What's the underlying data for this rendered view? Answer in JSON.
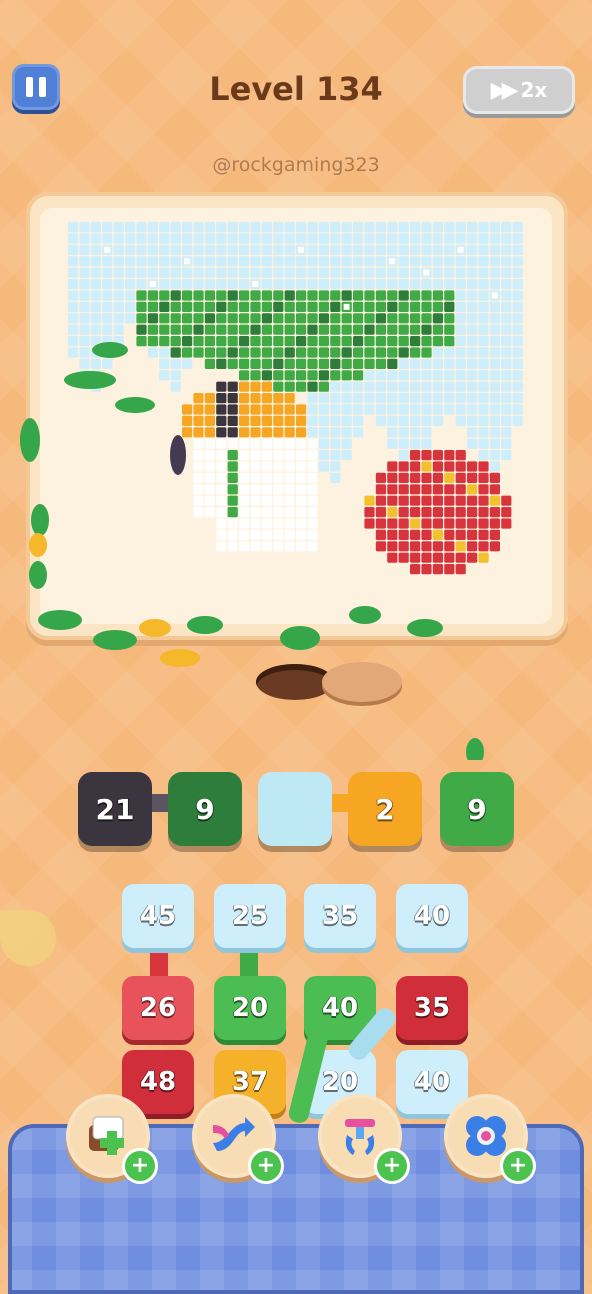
{
  "header": {
    "level_title": "Level 134",
    "speed_label": "2x",
    "speed_icon": "fast-forward-icon",
    "pause_icon": "pause-icon"
  },
  "watermark": "@rockgaming323",
  "colors": {
    "ice": "#cdeefa",
    "green": "#3faa46",
    "dark_green": "#2e7d3b",
    "red": "#d8343d",
    "orange": "#f6a623",
    "white": "#ffffff",
    "dark": "#3b3540"
  },
  "queue": [
    {
      "value": "21",
      "color": "#3b3540"
    },
    {
      "value": "9",
      "color": "#2e7d3b"
    },
    {
      "value": "",
      "color": "#bfe8f5"
    },
    {
      "value": "2",
      "color": "#f6a623"
    },
    {
      "value": "9",
      "color": "#3faa46"
    }
  ],
  "grid": {
    "row1": [
      "45",
      "25",
      "35",
      "40"
    ],
    "row2": [
      "26",
      "20",
      "40",
      "35"
    ],
    "row3": [
      "48",
      "37",
      "20",
      "40"
    ]
  },
  "boosters": [
    {
      "name": "add-slot",
      "icon": "add-tile-icon"
    },
    {
      "name": "shuffle",
      "icon": "shuffle-icon"
    },
    {
      "name": "claw",
      "icon": "claw-icon"
    },
    {
      "name": "flower",
      "icon": "flower-icon"
    }
  ]
}
